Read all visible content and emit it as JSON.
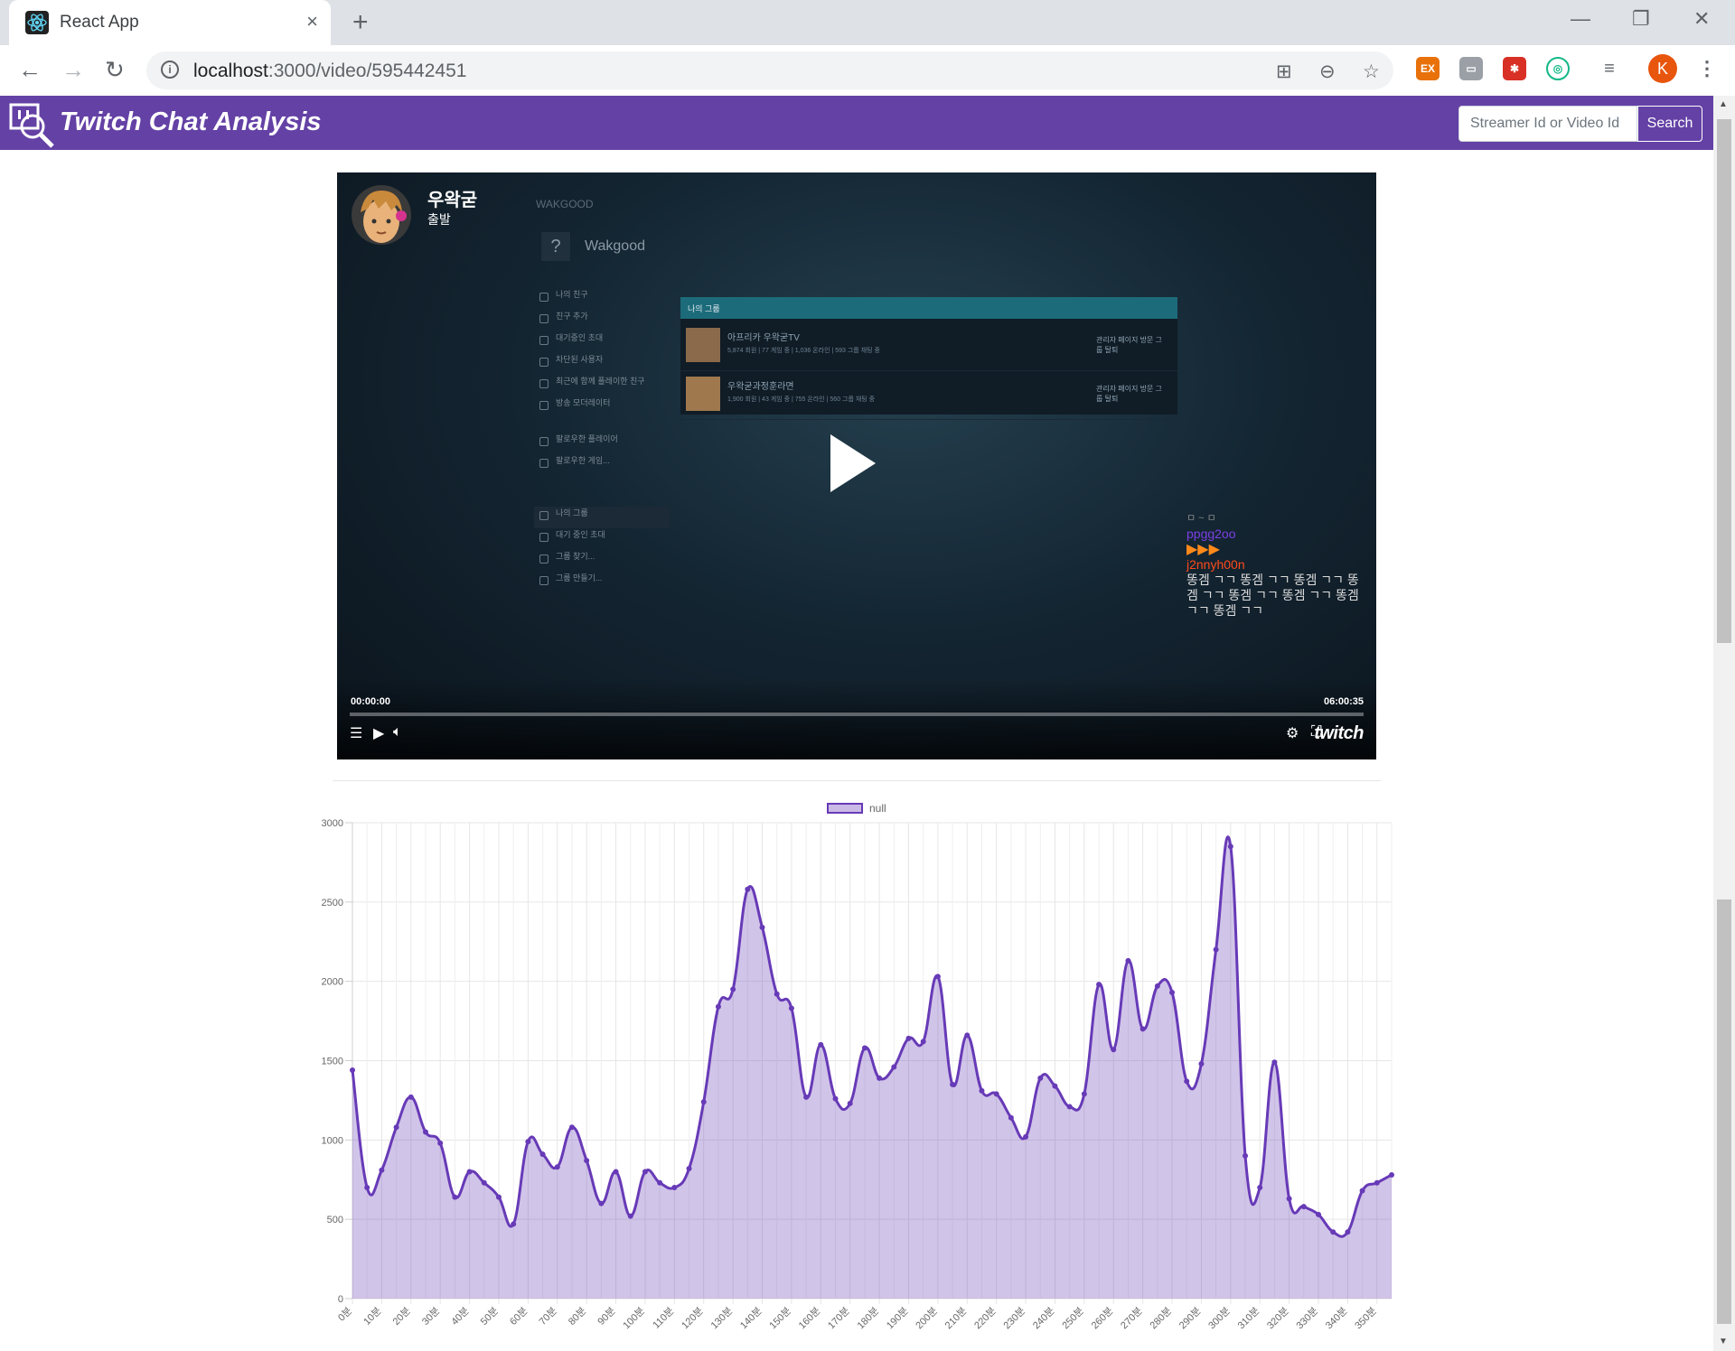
{
  "browser": {
    "tab_title": "React App",
    "tab_close": "×",
    "new_tab": "+",
    "url_host": "localhost",
    "url_rest": ":3000/video/595442451",
    "avatar_letter": "K",
    "ext_ex": "EX"
  },
  "header": {
    "brand": "Twitch Chat Analysis",
    "search_placeholder": "Streamer Id or Video Id",
    "search_button": "Search"
  },
  "player": {
    "streamer_name": "우왁굳",
    "stream_status": "출발",
    "game_header": "WAKGOOD",
    "game_profile": "Wakgood",
    "game_menu": [
      "나의 친구",
      "친구 추가",
      "대기중인 초대",
      "차단된 사용자",
      "최근에 함께 플레이한 친구",
      "방송 모더레이터",
      "팔로우한 플레이어",
      "팔로우한 게임...",
      "나의 그룹",
      "대기 중인 초대",
      "그룹 찾기...",
      "그룹 만들기..."
    ],
    "game_panel_title": "나의 그룹",
    "game_rows": [
      {
        "title": "아프리카 우왁굳TV",
        "sub": "5,874 회원 | 77 게임 중 | 1,036 온라인 | 593 그룹 채팅 중",
        "action": "관리자 페이지 방문 그룹 탈퇴"
      },
      {
        "title": "우왁굳과정훈라면",
        "sub": "1,900 회원 | 43 게임 중 | 755 온라인 | 560 그룹 채팅 중",
        "action": "관리자 페이지 방문 그룹 탈퇴"
      }
    ],
    "chat_line0": "ㅁ ~ ㅁ",
    "chat_user1": "ppgg2oo",
    "chat_emotes": "▶▶▶",
    "chat_user2": "j2nnyh00n",
    "chat_message": "똥겜 ㄱㄱ 똥겜 ㄱㄱ 똥겜 ㄱㄱ 똥겜 ㄱㄱ 똥겜 ㄱㄱ 똥겜 ㄱㄱ 똥겜 ㄱㄱ 똥겜 ㄱㄱ",
    "time_current": "00:00:00",
    "time_total": "06:00:35",
    "brand": "twitch"
  },
  "chart_data": {
    "type": "line",
    "filled": true,
    "series": [
      {
        "name": "null",
        "color": "#673ab7"
      }
    ],
    "ylim": [
      0,
      3000
    ],
    "yticks": [
      0,
      500,
      1000,
      1500,
      2000,
      2500,
      3000
    ],
    "x_tick_labels": [
      "0분",
      "10분",
      "20분",
      "30분",
      "40분",
      "50분",
      "60분",
      "70분",
      "80분",
      "90분",
      "100분",
      "110분",
      "120분",
      "130분",
      "140분",
      "150분",
      "160분",
      "170분",
      "180분",
      "190분",
      "200분",
      "210분",
      "220분",
      "230분",
      "240분",
      "250분",
      "260분",
      "270분",
      "280분",
      "290분",
      "300분",
      "310분",
      "320분",
      "330분",
      "340분",
      "350분"
    ],
    "values": [
      1440,
      700,
      810,
      1080,
      1270,
      1050,
      980,
      640,
      800,
      730,
      640,
      470,
      990,
      910,
      830,
      1080,
      870,
      600,
      800,
      520,
      800,
      730,
      700,
      820,
      1240,
      1840,
      1950,
      2580,
      2340,
      1920,
      1830,
      1270,
      1600,
      1260,
      1230,
      1580,
      1390,
      1460,
      1640,
      1620,
      2030,
      1350,
      1660,
      1310,
      1290,
      1140,
      1020,
      1390,
      1340,
      1210,
      1290,
      1980,
      1570,
      2130,
      1700,
      1970,
      1930,
      1370,
      1480,
      2200,
      2850,
      900,
      700,
      1490,
      630,
      580,
      530,
      420,
      420,
      680,
      730,
      780
    ]
  },
  "colors": {
    "header_bg": "#6441a5",
    "series_line": "#673ab7",
    "series_fill": "rgba(103,58,183,0.3)"
  }
}
